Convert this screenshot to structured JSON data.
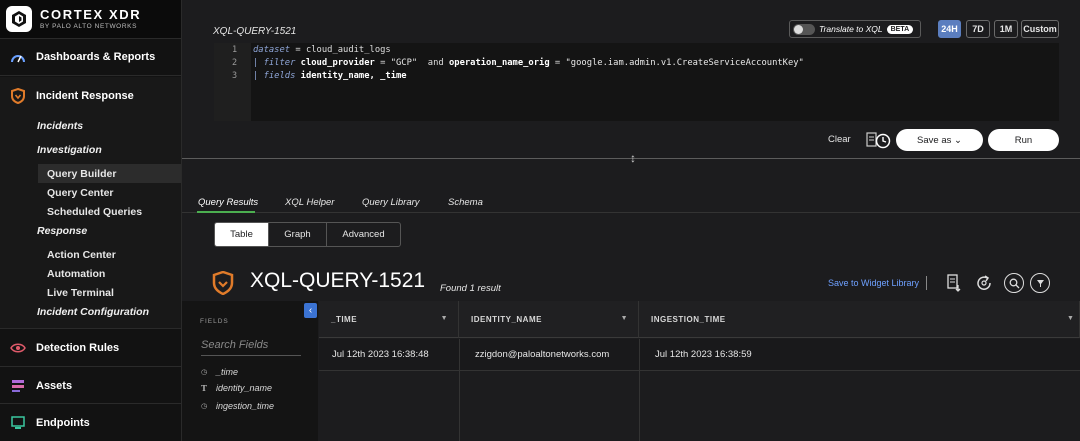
{
  "brand": {
    "name": "CORTEX XDR",
    "sub": "BY PALO ALTO NETWORKS"
  },
  "sidebar": {
    "dashboards": "Dashboards & Reports",
    "incident_response": "Incident Response",
    "incidents": "Incidents",
    "investigation": "Investigation",
    "query_builder": "Query Builder",
    "query_center": "Query Center",
    "scheduled_queries": "Scheduled Queries",
    "response": "Response",
    "action_center": "Action Center",
    "automation": "Automation",
    "live_terminal": "Live Terminal",
    "incident_configuration": "Incident Configuration",
    "detection_rules": "Detection Rules",
    "assets": "Assets",
    "endpoints": "Endpoints"
  },
  "query": {
    "title": "XQL-QUERY-1521",
    "translate_label": "Translate to XQL",
    "beta": "BETA",
    "ranges": [
      "24H",
      "7D",
      "1M",
      "Custom"
    ],
    "line_numbers": [
      "1",
      "2",
      "3"
    ],
    "line1": {
      "kw": "dataset",
      "rest": " = cloud_audit_logs"
    },
    "line2": {
      "pipe": "| ",
      "kw": "filter",
      "f1": " cloud_provider",
      "op1": " = ",
      "v1": "\"GCP\"",
      "and": "  and ",
      "f2": "operation_name_orig",
      "op2": " = ",
      "v2": "\"google.iam.admin.v1.CreateServiceAccountKey\""
    },
    "line3": {
      "pipe": "| ",
      "kw": "fields",
      "rest": " identity_name, _time"
    },
    "clear": "Clear",
    "save_as": "Save as ⌄",
    "run": "Run"
  },
  "results": {
    "tabs": [
      "Query Results",
      "XQL Helper",
      "Query Library",
      "Schema"
    ],
    "views": [
      "Table",
      "Graph",
      "Advanced"
    ],
    "title": "XQL-QUERY-1521",
    "count": "Found 1 result",
    "widget_link": "Save to Widget Library",
    "fields_header": "FIELDS",
    "search_placeholder": "Search Fields",
    "fields": [
      {
        "type": "time",
        "name": "_time"
      },
      {
        "type": "text",
        "name": "identity_name"
      },
      {
        "type": "time",
        "name": "ingestion_time"
      }
    ],
    "columns": [
      "_TIME",
      "IDENTITY_NAME",
      "INGESTION_TIME"
    ],
    "rows": [
      [
        "Jul 12th 2023 16:38:48",
        "zzigdon@paloaltonetworks.com",
        "Jul 12th 2023 16:38:59"
      ]
    ]
  },
  "colors": {
    "accent": "#5b7ebf",
    "tab_underline": "#4caf50",
    "link": "#6ea0ff",
    "shield": "#e07b2a"
  }
}
